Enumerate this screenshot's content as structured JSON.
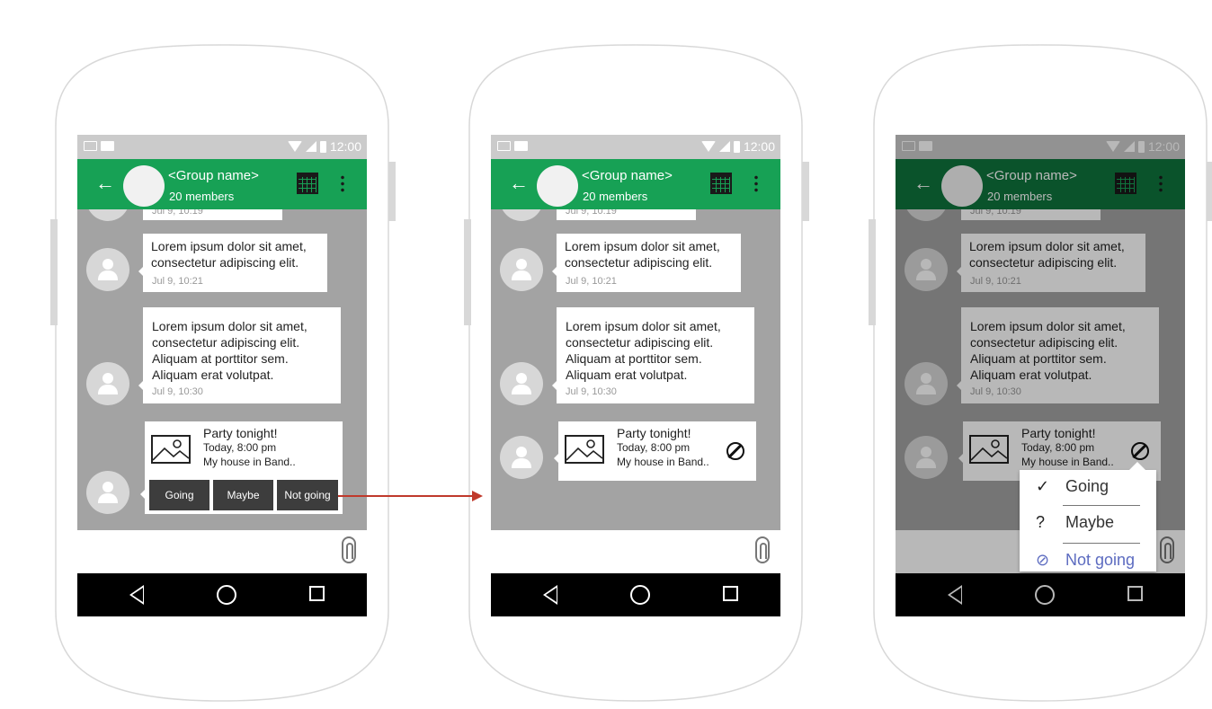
{
  "statusbar": {
    "time": "12:00"
  },
  "appbar": {
    "group_name": "<Group name>",
    "member_count": "20 members"
  },
  "messages": [
    {
      "text_line1": "Lorem ipsum dolor sit amet,",
      "text_line2": "consectetur adipiscing elit.",
      "time": "Jul 9, 10:21"
    },
    {
      "text_line1": "Lorem ipsum dolor sit amet,",
      "text_line2": "consectetur adipiscing elit.",
      "text_line3": "Aliquam at porttitor sem.",
      "text_line4": "Aliquam erat volutpat.",
      "time": "Jul 9, 10:30"
    }
  ],
  "partial_time": "Jul 9, 10:19",
  "event": {
    "title": "Party tonight!",
    "time": "Today, 8:00 pm",
    "place": "My house in Band.."
  },
  "rsvp_buttons": {
    "going": "Going",
    "maybe": "Maybe",
    "not_going": "Not going"
  },
  "rsvp_menu": [
    {
      "glyph": "✓",
      "label": "Going",
      "color": "#333333"
    },
    {
      "glyph": "?",
      "label": "Maybe",
      "color": "#333333"
    },
    {
      "glyph": "⊘",
      "label": "Not going",
      "color": "#5c6bc0"
    }
  ],
  "colors": {
    "appbar": "#17a155",
    "appbar_dimmed": "#0f733c",
    "chat_bg": "#a3a3a3",
    "arrow": "#c0392b"
  }
}
